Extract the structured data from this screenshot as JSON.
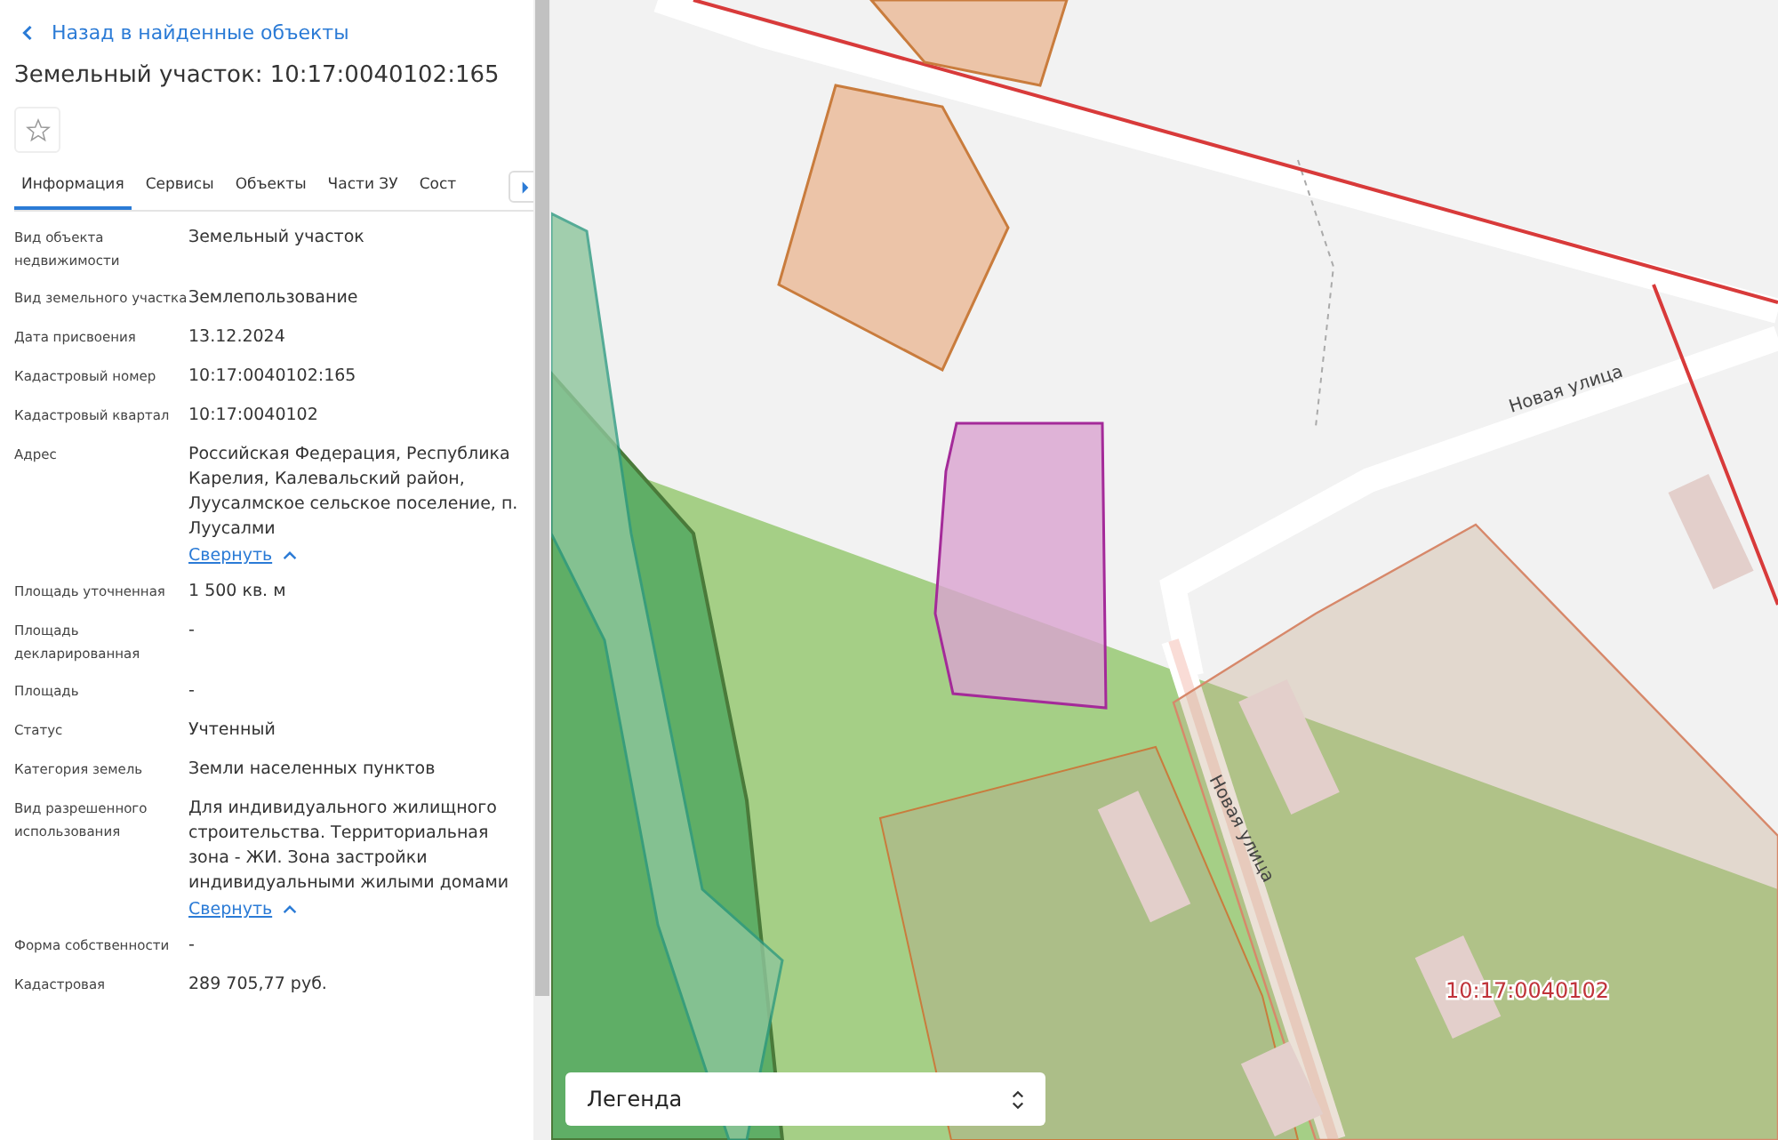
{
  "back_link": "Назад в найденные объекты",
  "title": "Земельный участок: 10:17:0040102:165",
  "favorite": {
    "on": false
  },
  "tabs": [
    {
      "label": "Информация",
      "selected": true
    },
    {
      "label": "Сервисы",
      "selected": false
    },
    {
      "label": "Объекты",
      "selected": false
    },
    {
      "label": "Части ЗУ",
      "selected": false
    },
    {
      "label": "Сост",
      "selected": false
    }
  ],
  "fields": [
    {
      "label": "Вид объекта недвижимости",
      "value": "Земельный участок"
    },
    {
      "label": "Вид земельного участка",
      "value": "Землепользование"
    },
    {
      "label": "Дата присвоения",
      "value": "13.12.2024"
    },
    {
      "label": "Кадастровый номер",
      "value": "10:17:0040102:165"
    },
    {
      "label": "Кадастровый квартал",
      "value": "10:17:0040102"
    },
    {
      "label": "Адрес",
      "value": "Российская Федерация, Республика Карелия, Калевальский район, Луусалмское сельское поселение, п. Луусалми",
      "collapse_link": "Свернуть"
    },
    {
      "label": "Площадь уточненная",
      "value": "1 500 кв. м"
    },
    {
      "label": "Площадь декларированная",
      "value": "-"
    },
    {
      "label": "Площадь",
      "value": "-"
    },
    {
      "label": "Статус",
      "value": "Учтенный"
    },
    {
      "label": "Категория земель",
      "value": "Земли населенных пунктов"
    },
    {
      "label": "Вид разрешенного использования",
      "value": "Для индивидуального жилищного строительства. Территориальная зона - ЖИ. Зона застройки индивидуальными жилыми домами",
      "collapse_link": "Свернуть"
    },
    {
      "label": "Форма собственности",
      "value": "-"
    },
    {
      "label": "Кадастровая",
      "value": "289 705,77 руб."
    }
  ],
  "map": {
    "street_labels": [
      "Новая улица",
      "Новая улица"
    ],
    "quarter_label": "10:17:0040102"
  },
  "legend": {
    "label": "Легенда"
  }
}
